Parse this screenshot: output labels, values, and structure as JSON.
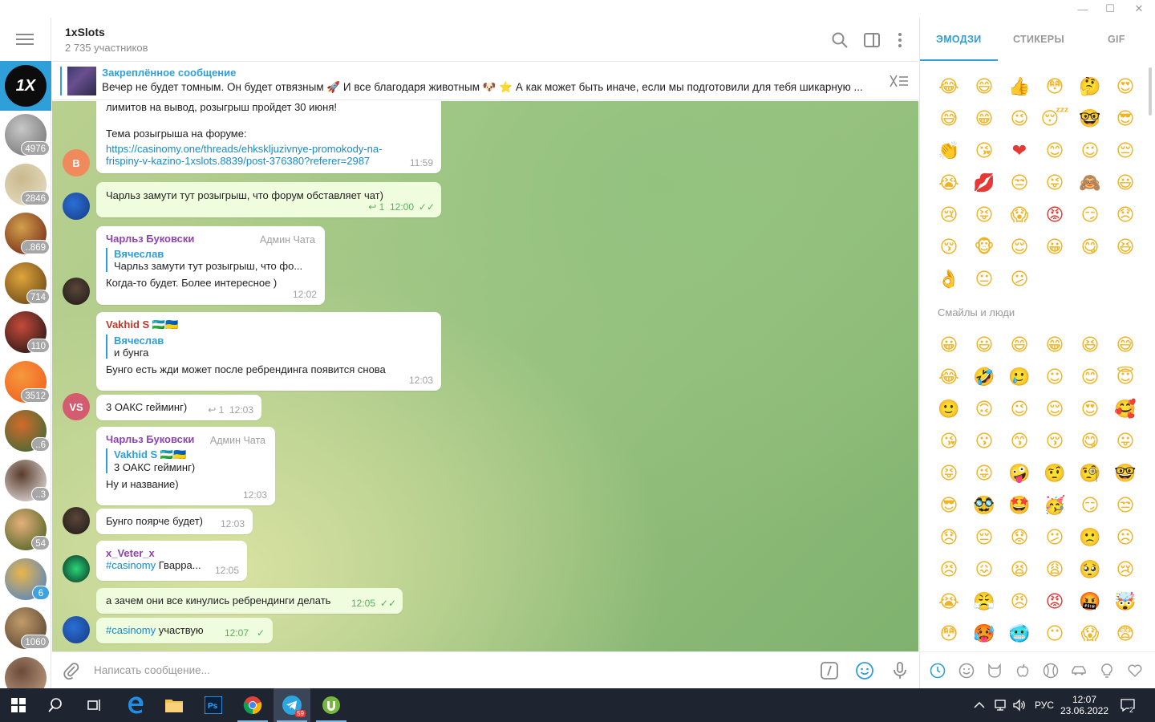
{
  "window": {
    "minimize": "—",
    "maximize": "☐",
    "close": "✕"
  },
  "sidebar": {
    "dialogs": [
      {
        "badge": "",
        "colors": [
          "#101010",
          "#f3c21a"
        ]
      },
      {
        "badge": "4976",
        "colors": [
          "#6d6d6d",
          "#c7c7c7"
        ]
      },
      {
        "badge": "2846",
        "colors": [
          "#e8e0c8",
          "#c9b98d"
        ]
      },
      {
        "badge": "..869",
        "colors": [
          "#6b1b14",
          "#d2a04a"
        ]
      },
      {
        "badge": "714",
        "colors": [
          "#5a3c12",
          "#e0a43c"
        ]
      },
      {
        "badge": "110",
        "colors": [
          "#121212",
          "#c54a3a"
        ]
      },
      {
        "badge": "3512",
        "colors": [
          "#f0561c",
          "#f59a3d"
        ]
      },
      {
        "badge": "..6",
        "colors": [
          "#2a6a3a",
          "#d36a2a"
        ]
      },
      {
        "badge": "..3",
        "colors": [
          "#f2f2f2",
          "#5a3a2a"
        ]
      },
      {
        "badge": "54",
        "colors": [
          "#3a5a1a",
          "#e4b07a"
        ]
      },
      {
        "badge": "6",
        "colors": [
          "#3f7fd6",
          "#e9b54a"
        ]
      },
      {
        "badge": "1060",
        "colors": [
          "#4a3a2a",
          "#c29b6b"
        ]
      },
      {
        "badge": "",
        "colors": [
          "#c9a88a",
          "#6b4a3a"
        ]
      }
    ]
  },
  "header": {
    "title": "1xSlots",
    "subtitle": "2 735 участников"
  },
  "pinned": {
    "title": "Закреплённое сообщение",
    "text": "Вечер не будет томным. Он будет отвязным 🚀 И все благодаря животным 🐶 ⭐ А как может быть иначе, если мы подготовили для тебя шикарную ..."
  },
  "messages": {
    "m1": {
      "line1": "лимитов на вывод, розыгрыш пройдет 30 июня!",
      "line2": "Тема розыгрыша на форуме:",
      "link1": "https://casinomy.one/threads/ehksklјuzivnye-promokody-na-",
      "link2": "frispiny-v-kazino-1xslots.8839/post-376380?referer=2987",
      "time": "11:59",
      "avatar": "В"
    },
    "m2": {
      "text": "Чарльз замути тут розыгрыш, что форум обставляет чат)",
      "replies": "1",
      "time": "12:00"
    },
    "m3": {
      "name": "Чарльз Буковски",
      "role": "Админ Чата",
      "reply_name": "Вячеслав",
      "reply_text": "Чарльз замути тут розыгрыш, что фо...",
      "text": "Когда-то будет. Более интересное )",
      "time": "12:02"
    },
    "m4": {
      "name": "Vakhid S 🇺🇿🇺🇦",
      "reply_name": "Вячеслав",
      "reply_text": "и бунга",
      "text": "Бунго есть жди может после ребрендинга появится снова",
      "time": "12:03"
    },
    "m5": {
      "text": "3 ОАКС гейминг)",
      "replies": "1",
      "time": "12:03",
      "avatar": "VS"
    },
    "m6": {
      "name": "Чарльз Буковски",
      "role": "Админ Чата",
      "reply_name": "Vakhid S 🇺🇿🇺🇦",
      "reply_text": "3 ОАКС гейминг)",
      "text": "Ну и название)",
      "time": "12:03"
    },
    "m7": {
      "text": "Бунго поярче будет)",
      "time": "12:03"
    },
    "m8": {
      "name": "x_Veter_x",
      "tag": "#casinomy",
      "text": " Гварра...",
      "time": "12:05"
    },
    "m9": {
      "text": "а зачем они все кинулись ребрендинги делать",
      "time": "12:05"
    },
    "m10": {
      "tag": "#casinomy",
      "text": " участвую",
      "time": "12:07"
    }
  },
  "composer": {
    "placeholder": "Написать сообщение..."
  },
  "panel": {
    "tabs": [
      "ЭМОДЗИ",
      "СТИКЕРЫ",
      "GIF"
    ],
    "recent": [
      "😂",
      "😄",
      "👍",
      "😳",
      "🤔",
      "😍",
      "😅",
      "😁",
      "😉",
      "😴",
      "🤓",
      "😎",
      "👏",
      "😘",
      "❤",
      "😊",
      "☺",
      "😔",
      "😭",
      "💋",
      "😒",
      "😜",
      "🙈",
      "😃",
      "😢",
      "😝",
      "😱",
      "😡",
      "😏",
      "😞",
      "😚",
      "🐵",
      "😌",
      "😀",
      "😋",
      "😆",
      "👌",
      "😐",
      "😕"
    ],
    "section": "Смайлы и люди",
    "smileys": [
      "😀",
      "😃",
      "😄",
      "😁",
      "😆",
      "😅",
      "😂",
      "🤣",
      "🥲",
      "☺",
      "😊",
      "😇",
      "🙂",
      "🙃",
      "😉",
      "😌",
      "😍",
      "🥰",
      "😘",
      "😗",
      "😙",
      "😚",
      "😋",
      "😛",
      "😝",
      "😜",
      "🤪",
      "🤨",
      "🧐",
      "🤓",
      "😎",
      "🥸",
      "🤩",
      "🥳",
      "😏",
      "😒",
      "😞",
      "😔",
      "😟",
      "😕",
      "🙁",
      "☹",
      "😣",
      "😖",
      "😫",
      "😩",
      "🥺",
      "😢",
      "😭",
      "😤",
      "😠",
      "😡",
      "🤬",
      "🤯",
      "😳",
      "🥵",
      "🥶",
      "😶",
      "😱",
      "😨"
    ]
  },
  "taskbar": {
    "telegram_badge": "59",
    "lang": "РУС",
    "time": "12:07",
    "date": "23.06.2022",
    "notifications": "2"
  }
}
